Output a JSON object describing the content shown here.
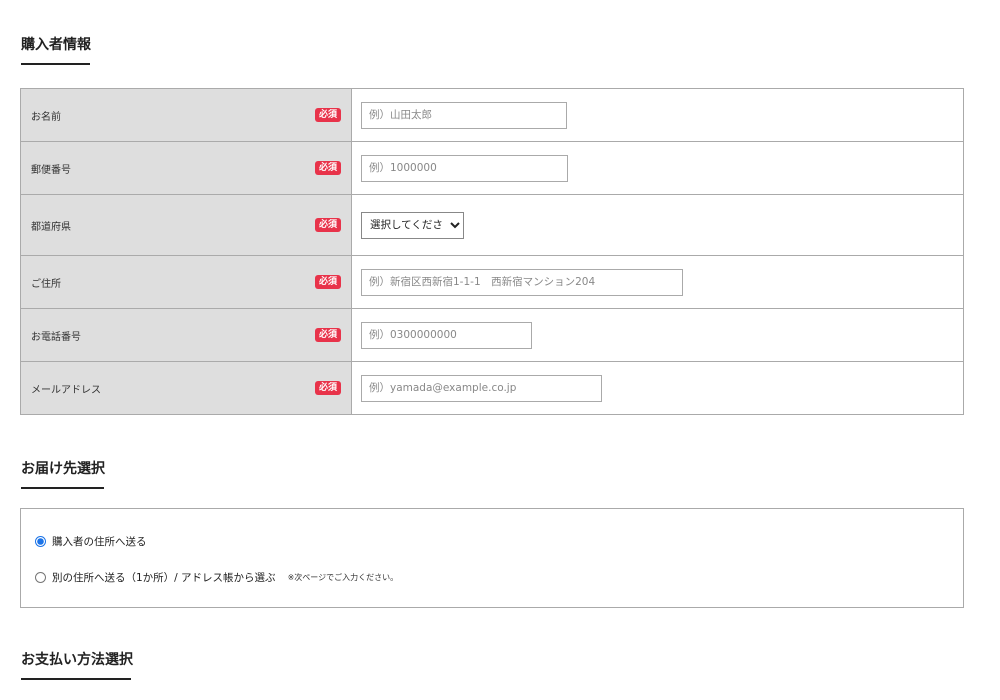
{
  "sections": {
    "buyer_title": "購入者情報",
    "delivery_title": "お届け先選択",
    "payment_title": "お支払い方法選択"
  },
  "required_label": "必須",
  "fields": {
    "name": {
      "label": "お名前",
      "placeholder": "例）山田太郎"
    },
    "postal": {
      "label": "郵便番号",
      "placeholder": "例）1000000"
    },
    "prefecture": {
      "label": "都道府県",
      "selected": "選択してください"
    },
    "address": {
      "label": "ご住所",
      "placeholder": "例）新宿区西新宿1-1-1　西新宿マンション204"
    },
    "phone": {
      "label": "お電話番号",
      "placeholder": "例）0300000000"
    },
    "email": {
      "label": "メールアドレス",
      "placeholder": "例）yamada@example.co.jp"
    }
  },
  "delivery": {
    "option1": "購入者の住所へ送る",
    "option2": "別の住所へ送る（1か所）/ アドレス帳から選ぶ",
    "option2_note": "※次ページでご入力ください。",
    "selected": "option1"
  },
  "colors": {
    "required_badge": "#e8334a",
    "label_bg": "#dedede",
    "radio_accent": "#1a73e8"
  }
}
